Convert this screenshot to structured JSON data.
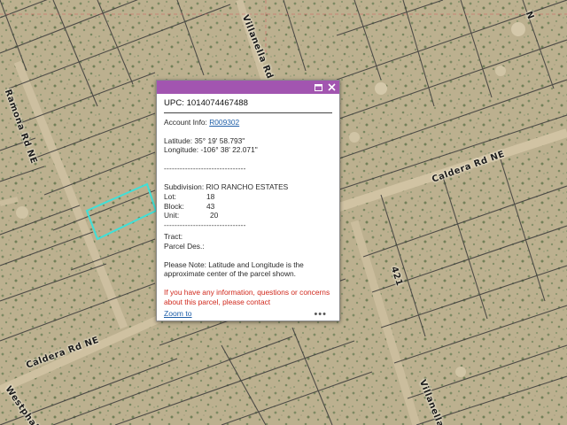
{
  "map": {
    "roads": {
      "road_1": "Villanella Rd NE",
      "road_2": "Caldera Rd NE",
      "road_3": "Caldera Rd NE",
      "road_4": "421",
      "road_5": "Ramona Rd NE",
      "road_6": "Villanella R",
      "road_7": "Westphalia"
    },
    "colors": {
      "terrain": "#b9ae8c",
      "parcel_line": "#3a3a3a",
      "selected_parcel": "#3fe0d8",
      "popup_header": "#a255b0"
    }
  },
  "popup": {
    "header": {
      "maximize_icon": "maximize-icon",
      "close_icon": "close-icon"
    },
    "upc": "UPC: 1014074467488",
    "account_label": "Account Info: ",
    "account_link": "R009302",
    "latitude": "Latitude: 35° 19' 58.793\"",
    "longitude": "Longitude: -106° 38' 22.071\"",
    "divider": "-------------------------------",
    "subdivision": "Subdivision: RIO RANCHO ESTATES",
    "lot_label": "Lot:",
    "lot_value": "18",
    "block_label": "Block:",
    "block_value": "43",
    "unit_label": "Unit:",
    "unit_value": "20",
    "tract": "Tract:",
    "parcel_des": "Parcel Des.:",
    "note": "Please Note: Latitude and Longitude is the approximate center of the parcel shown.",
    "contact": "If you have any information, questions or concerns about this parcel, please contact",
    "zoom_link": "Zoom to",
    "more": "•••"
  }
}
